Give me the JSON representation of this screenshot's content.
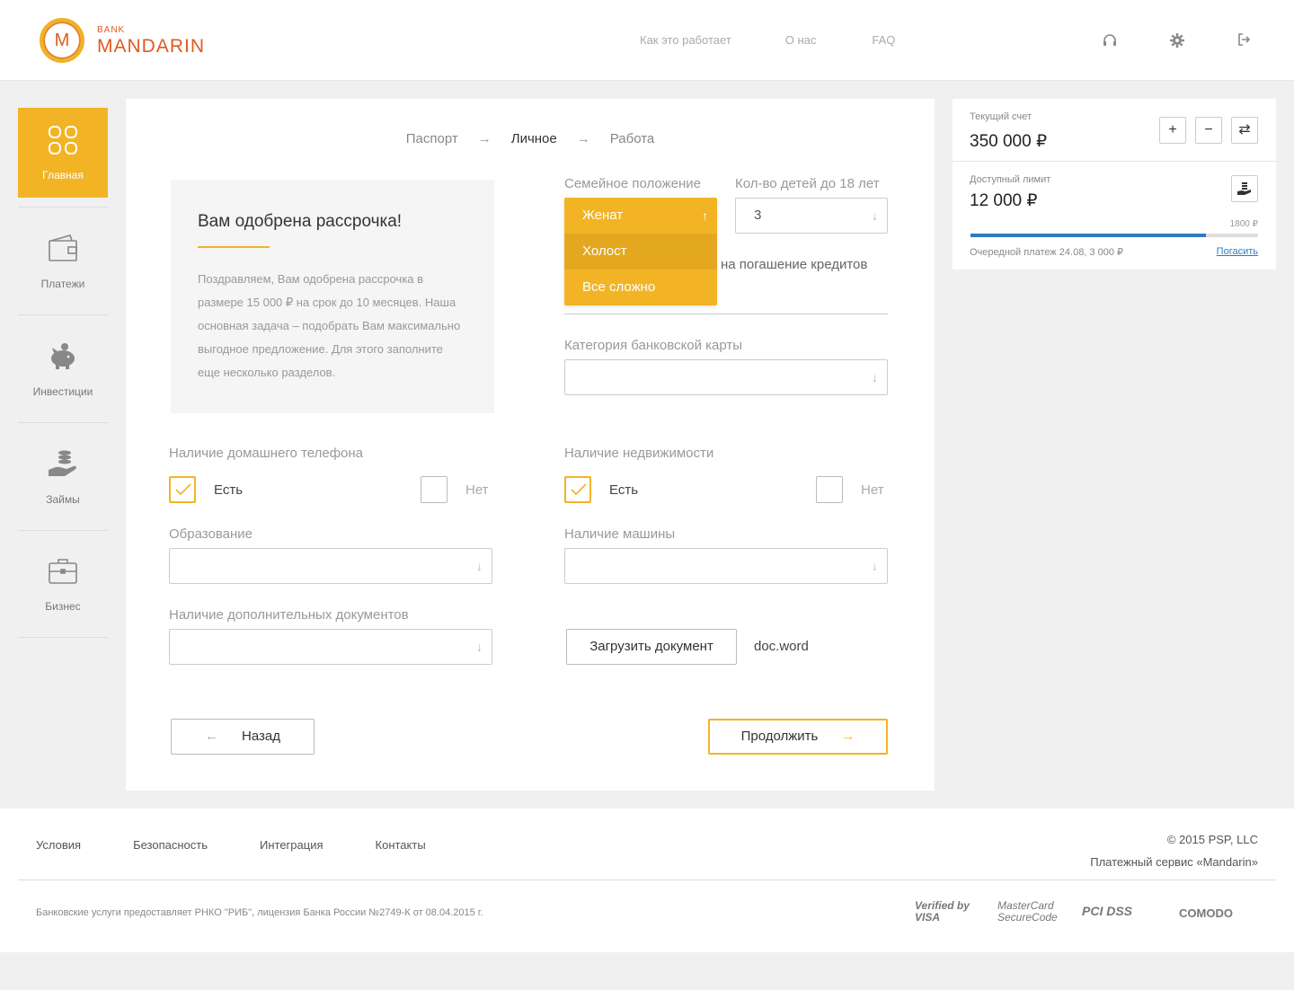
{
  "brand": {
    "bank": "BANK",
    "name": "MANDARIN",
    "letter": "M"
  },
  "topnav": [
    "Как это работает",
    "О нас",
    "FAQ"
  ],
  "header_icons": [
    "headset-icon",
    "gear-icon",
    "logout-icon"
  ],
  "sidebar": [
    {
      "label": "Главная",
      "icon": "grid-icon",
      "active": true
    },
    {
      "label": "Платежи",
      "icon": "wallet-icon"
    },
    {
      "label": "Инвестиции",
      "icon": "piggy-bank-icon"
    },
    {
      "label": "Займы",
      "icon": "coins-hand-icon"
    },
    {
      "label": "Бизнес",
      "icon": "briefcase-icon"
    }
  ],
  "steps": [
    "Паспорт",
    "Личное",
    "Работа"
  ],
  "step_arrow": "→",
  "approval": {
    "title": "Вам одобрена рассрочка!",
    "text": "Поздравляем, Вам одобрена рассрочка в размере 15 000 ₽ на срок до 10 месяцев. Наша основная задача – подобрать Вам максимально выгодное предложение. Для этого заполните еще несколько разделов."
  },
  "form": {
    "marital_label": "Семейное положение",
    "marital_options": [
      "Женат",
      "Холост",
      "Все сложно"
    ],
    "children_label": "Кол-во детей до 18 лет",
    "children_value": "3",
    "credit_partial": "на погашение кредитов",
    "card_category_label": "Категория банковской карты",
    "home_phone_label": "Наличие домашнего телефона",
    "realty_label": "Наличие недвижимости",
    "yes": "Есть",
    "no": "Нет",
    "education_label": "Образование",
    "car_label": "Наличие машины",
    "extra_docs_label": "Наличие дополнительных документов",
    "upload_button": "Загрузить документ",
    "uploaded_file": "doc.word",
    "back_button": "Назад",
    "continue_button": "Продолжить",
    "arrow_left": "←",
    "arrow_right": "→",
    "chevron_down": "↓",
    "chevron_up": "↑"
  },
  "account": {
    "current_label": "Текущий счет",
    "current_value": "350 000 ₽",
    "limit_label": "Доступный лимит",
    "limit_value": "12 000 ₽",
    "progress_label": "1800 ₽",
    "progress_fraction": 0.82,
    "next_payment": "Очередной платеж 24.08, 3 000 ₽",
    "pay_link": "Погасить",
    "plus": "+",
    "minus": "−",
    "swap": "⇄"
  },
  "footer": {
    "links": [
      "Условия",
      "Безопасность",
      "Интеграция",
      "Контакты"
    ],
    "copyright": "© 2015 PSP, LLC",
    "service": "Платежный сервис «Mandarin»",
    "legal": "Банковские услуги предоставляет РНКО \"РИБ\", лицензия Банка России №2749-К от 08.04.2015 г.",
    "badges": [
      "Verified by VISA",
      "MasterCard SecureCode",
      "PCI DSS",
      "COMODO"
    ]
  },
  "colors": {
    "accent": "#f2b425",
    "brand": "#e05a1e",
    "progress": "#2f7bbd"
  }
}
